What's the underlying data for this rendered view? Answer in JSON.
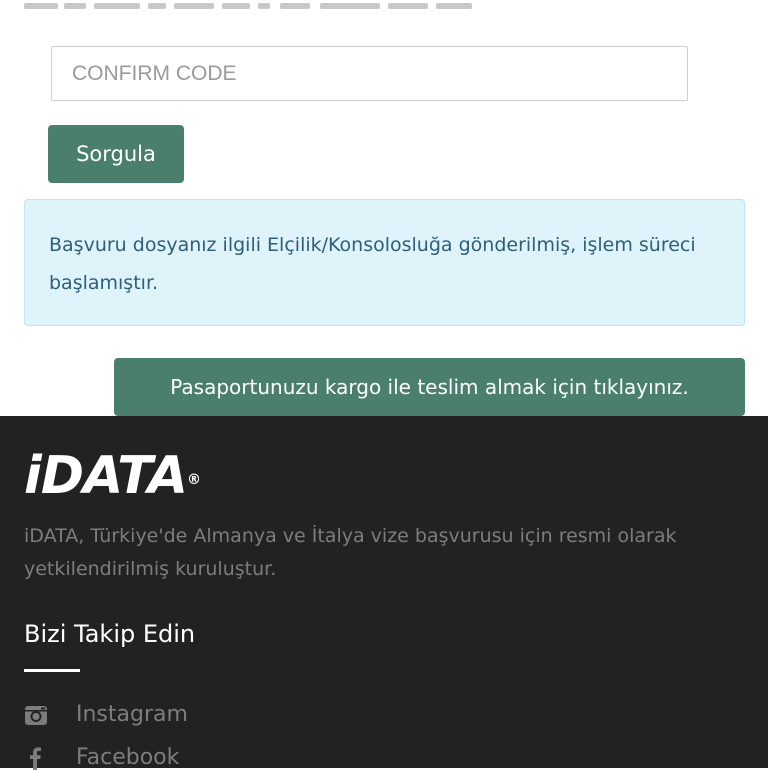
{
  "form": {
    "code_placeholder": "CONFIRM CODE",
    "submit_label": "Sorgula"
  },
  "status": {
    "message": "Başvuru dosyanız ilgili Elçilik/Konsolosluğa gönderilmiş, işlem süreci başlamıştır."
  },
  "cargo": {
    "button_label": "Pasaportunuzu kargo ile teslim almak için tıklayınız."
  },
  "footer": {
    "logo_text": "iDATA",
    "registered_mark": "®",
    "description": "iDATA, Türkiye'de Almanya ve İtalya vize başvurusu için resmi olarak yetkilendirilmiş kuruluştur.",
    "follow_title": "Bizi Takip Edin",
    "social": [
      {
        "label": "Instagram",
        "icon": "instagram-icon"
      },
      {
        "label": "Facebook",
        "icon": "facebook-icon"
      }
    ]
  },
  "colors": {
    "primary_button": "#4a7f6e",
    "info_background": "#dff3fb",
    "info_text": "#2d5f7a",
    "footer_background": "#222222"
  }
}
